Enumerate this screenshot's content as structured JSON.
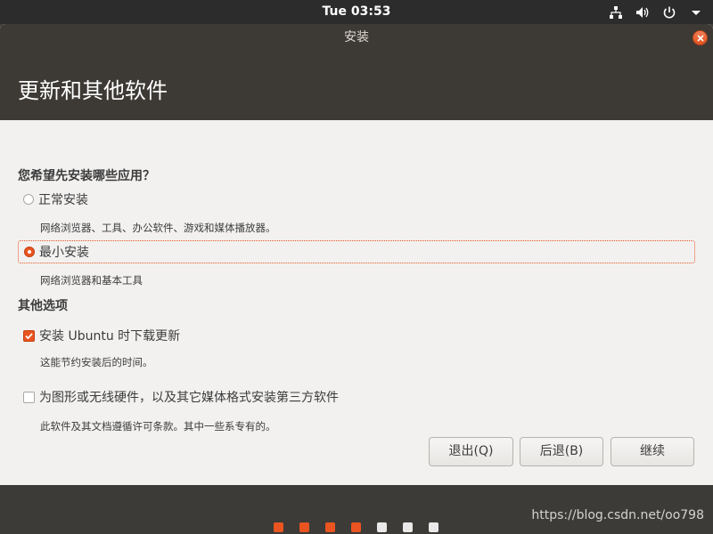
{
  "top_panel": {
    "clock": "Tue 03:53",
    "icons": [
      "network-icon",
      "volume-icon",
      "power-icon",
      "chevron-down-icon"
    ]
  },
  "window": {
    "title": "安装",
    "page_title": "更新和其他软件"
  },
  "question": {
    "heading": "您希望先安装哪些应用？",
    "options": [
      {
        "label": "正常安装",
        "description": "网络浏览器、工具、办公软件、游戏和媒体播放器。",
        "selected": false
      },
      {
        "label": "最小安装",
        "description": "网络浏览器和基本工具",
        "selected": true
      }
    ]
  },
  "other_options": {
    "heading": "其他选项",
    "items": [
      {
        "label": "安装 Ubuntu 时下载更新",
        "description": "这能节约安装后的时间。",
        "checked": true
      },
      {
        "label": "为图形或无线硬件，以及其它媒体格式安装第三方软件",
        "description": "此软件及其文档遵循许可条款。其中一些系专有的。",
        "checked": false
      }
    ]
  },
  "buttons": {
    "quit": "退出(Q)",
    "back": "后退(B)",
    "continue": "继续"
  },
  "progress": {
    "steps_total": 7,
    "steps_completed": 4
  },
  "watermark": "https://blog.csdn.net/oo798",
  "colors": {
    "accent": "#e95420",
    "header_bg": "#3d3a35",
    "window_bg": "#f2f1f0"
  }
}
